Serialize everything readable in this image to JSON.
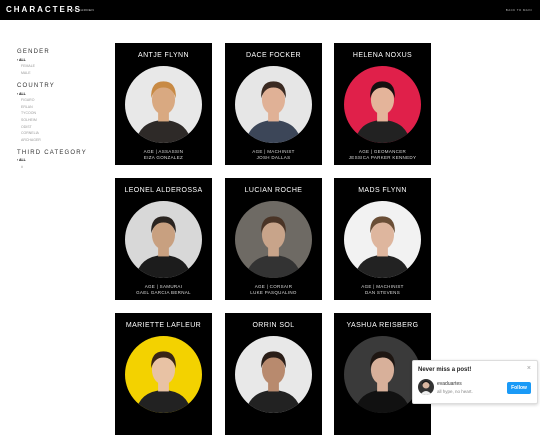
{
  "header": {
    "brand": "CHARACTERS",
    "brand_sub": "OF CARDEN",
    "back_link": "BACK TO MAIN"
  },
  "sidebar": {
    "sections": [
      {
        "title": "GENDER",
        "options": [
          {
            "label": "ALL",
            "active": true
          },
          {
            "label": "FEMALE",
            "active": false
          },
          {
            "label": "MALE",
            "active": false
          }
        ]
      },
      {
        "title": "COUNTRY",
        "options": [
          {
            "label": "ALL",
            "active": true
          },
          {
            "label": "FIGARO",
            "active": false
          },
          {
            "label": "ERLAN",
            "active": false
          },
          {
            "label": "TYCOON",
            "active": false
          },
          {
            "label": "SOLHEIM",
            "active": false
          },
          {
            "label": "ODIST",
            "active": false
          },
          {
            "label": "CORNELIA",
            "active": false
          },
          {
            "label": "ARCHAGER",
            "active": false
          }
        ]
      },
      {
        "title": "THIRD CATEGORY",
        "options": [
          {
            "label": "ALL",
            "active": true
          },
          {
            "label": "#",
            "active": false
          }
        ]
      }
    ]
  },
  "cards": [
    {
      "name": "ANTJE FLYNN",
      "meta": "AGE | ASSASSIN",
      "actor": "EIZA GONZALEZ",
      "bg": "#e8e8e8",
      "skin": "#d9a981",
      "hair": "#c88a44",
      "cloth": "#2e2a28"
    },
    {
      "name": "DACE FOCKER",
      "meta": "AGE | MACHINIST",
      "actor": "JOSH DALLAS",
      "bg": "#e6e6e6",
      "skin": "#e0b196",
      "hair": "#3a2a22",
      "cloth": "#3c4658"
    },
    {
      "name": "HELENA NOXUS",
      "meta": "AGE | GEOMANCER",
      "actor": "JESSICA PARKER KENNEDY",
      "bg": "#e0204a",
      "skin": "#e4b49a",
      "hair": "#151010",
      "cloth": "#222"
    },
    {
      "name": "LEONEL ALDEROSSA",
      "meta": "AGE | SAMURAI",
      "actor": "GAEL GARCIA BERNAL",
      "bg": "#d8d8d8",
      "skin": "#c8a080",
      "hair": "#2a2420",
      "cloth": "#1c1c1c"
    },
    {
      "name": "LUCIAN ROCHE",
      "meta": "AGE | CORSAIR",
      "actor": "LUKE PASQUALINO",
      "bg": "#6e6a64",
      "skin": "#c8a48a",
      "hair": "#4a3426",
      "cloth": "#333"
    },
    {
      "name": "MADS FLYNN",
      "meta": "AGE | MACHINIST",
      "actor": "DAN STEVENS",
      "bg": "#f2f2f2",
      "skin": "#deb69e",
      "hair": "#6a4e36",
      "cloth": "#222"
    },
    {
      "name": "MARIETTE LAFLEUR",
      "meta": "",
      "actor": "",
      "bg": "#f3d200",
      "skin": "#e8c2a4",
      "hair": "#3a2516",
      "cloth": "#222"
    },
    {
      "name": "ORRIN SOL",
      "meta": "",
      "actor": "",
      "bg": "#e8e8e8",
      "skin": "#b88a6e",
      "hair": "#2a1e18",
      "cloth": "#222"
    },
    {
      "name": "YASHUA REISBERG",
      "meta": "",
      "actor": "",
      "bg": "#3a3a3a",
      "skin": "#d8b09a",
      "hair": "#1e1612",
      "cloth": "#111"
    }
  ],
  "popup": {
    "title": "Never miss a post!",
    "user": "evaduartes",
    "tagline": "all hype, no heart.",
    "follow_label": "Follow",
    "close_glyph": "×"
  }
}
